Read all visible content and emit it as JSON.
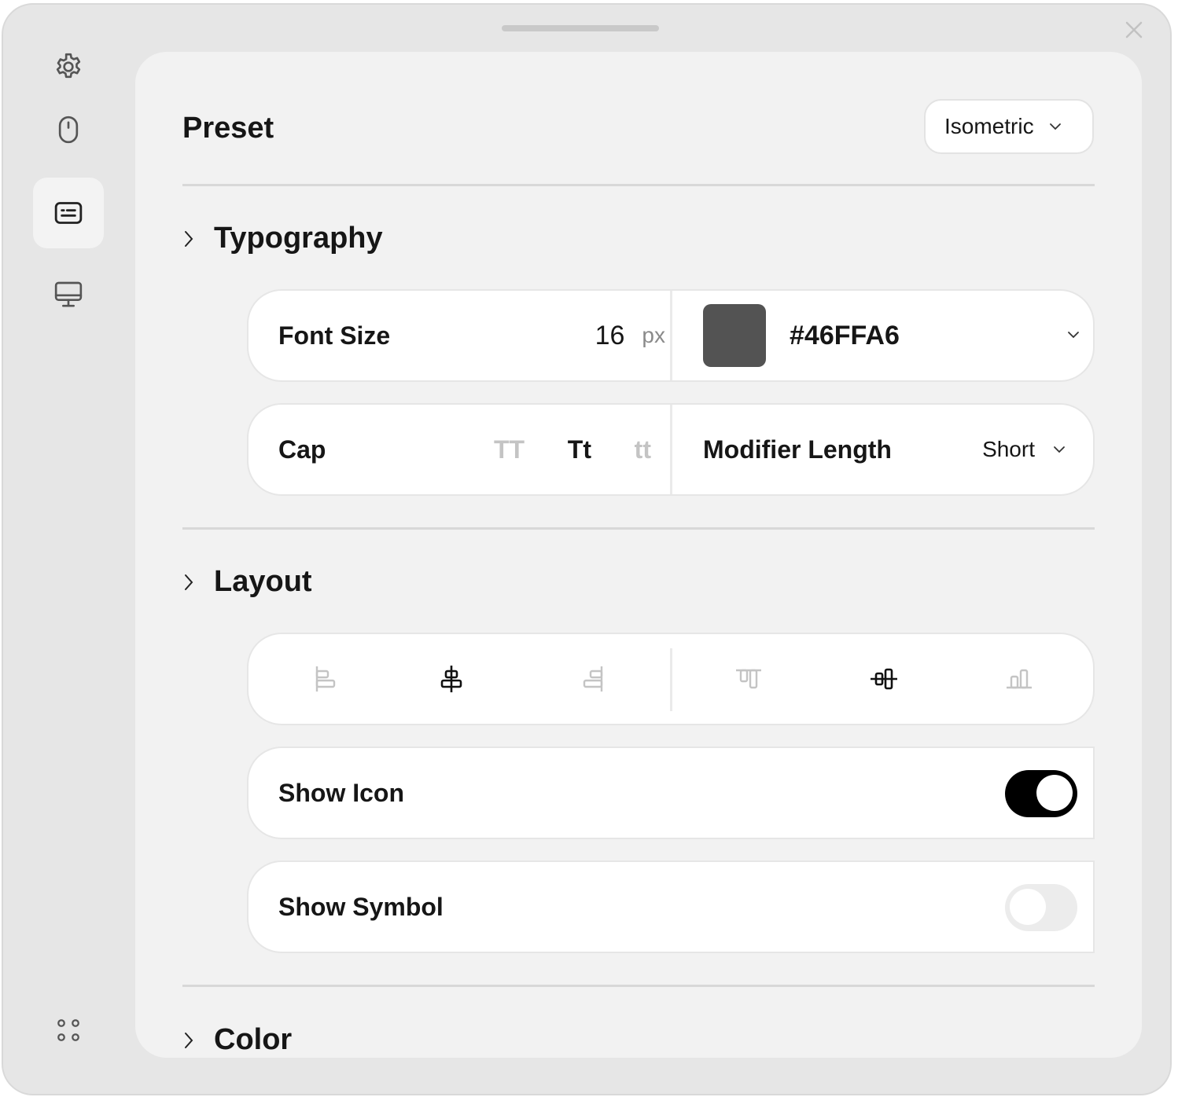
{
  "window": {
    "close_icon": "close-icon"
  },
  "sidebar": {
    "items": [
      {
        "name": "settings",
        "icon": "gear-icon"
      },
      {
        "name": "mouse",
        "icon": "mouse-icon"
      },
      {
        "name": "caption",
        "icon": "caption-icon",
        "active": true
      },
      {
        "name": "display",
        "icon": "monitor-icon"
      }
    ],
    "bottom_icon": "apps-grid-icon"
  },
  "preset": {
    "title": "Preset",
    "value": "Isometric"
  },
  "typography": {
    "title": "Typography",
    "font_size_label": "Font Size",
    "font_size_value": "16",
    "font_size_unit": "px",
    "color_hex": "#46FFA6",
    "swatch_color": "#535353",
    "cap_label": "Cap",
    "cap_options": [
      "TT",
      "Tt",
      "tt"
    ],
    "cap_selected": "Tt",
    "modifier_label": "Modifier Length",
    "modifier_value": "Short"
  },
  "layout": {
    "title": "Layout",
    "horizontal_align": [
      "align-left-icon",
      "align-center-icon",
      "align-right-icon"
    ],
    "horizontal_selected": "align-center-icon",
    "vertical_align": [
      "align-top-icon",
      "align-middle-icon",
      "align-bottom-icon"
    ],
    "vertical_selected": "align-middle-icon",
    "show_icon_label": "Show Icon",
    "show_icon_on": true,
    "show_symbol_label": "Show Symbol",
    "show_symbol_on": false
  },
  "color_section": {
    "title": "Color"
  },
  "colors": {
    "window_bg": "#e6e6e6",
    "panel_bg": "#f2f2f2",
    "toggle_on": "#000000",
    "toggle_off": "#ececec",
    "muted_text": "#c4c4c4"
  }
}
